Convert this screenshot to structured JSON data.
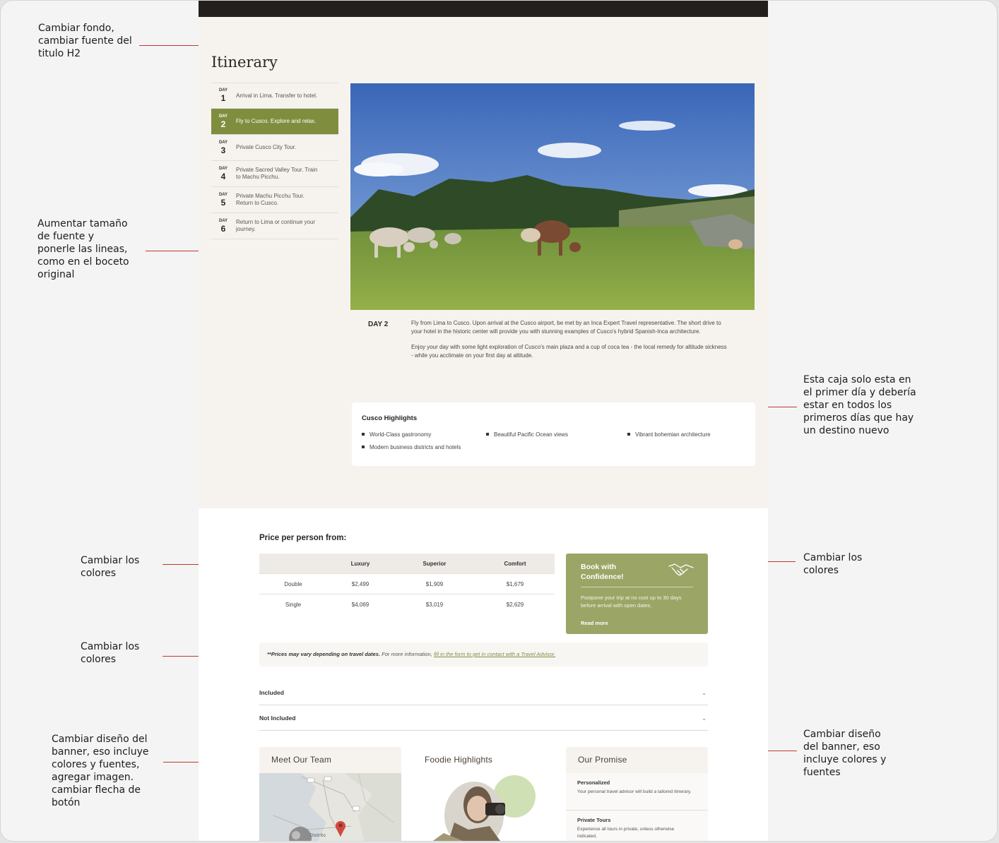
{
  "annotations": [
    "Cambiar fondo,\ncambiar fuente del\ntitulo H2",
    "Aumentar tamaño\nde fuente y\nponerle las lineas,\ncomo en el boceto\noriginal",
    "Esta caja solo esta en\nel primer día y debería\nestar en todos los\nprimeros días que hay\nun destino nuevo",
    "Cambiar los\ncolores",
    "Cambiar los\ncolores",
    "Cambiar los\ncolores",
    "Cambiar diseño del\nbanner, eso incluye\ncolores y fuentes,\nagregar imagen.\ncambiar flecha de\nbotón",
    "Cambiar diseño\ndel banner, eso\nincluye colores y\nfuentes"
  ],
  "itinerary": {
    "title": "Itinerary",
    "day_label": "DAY",
    "days": [
      {
        "num": "1",
        "text": "Arrival in Lima. Transfer to hotel."
      },
      {
        "num": "2",
        "text": "Fly to Cusco. Explore and relax."
      },
      {
        "num": "3",
        "text": "Private Cusco City Tour."
      },
      {
        "num": "4",
        "text": "Private Sacred Valley Tour. Train to Machu Picchu."
      },
      {
        "num": "5",
        "text": "Private Machu Picchu Tour. Return to Cusco."
      },
      {
        "num": "6",
        "text": "Return to Lima or continue your journey."
      }
    ],
    "active_day": "2",
    "detail_tag": "DAY 2",
    "detail_p1": "Fly from Lima to Cusco. Upon arrival at the Cusco airport, be met by an Inca Expert Travel representative. The short drive to your hotel in the historic center will provide you with stunning examples of Cusco's hybrid Spanish-Inca architecture.",
    "detail_p2": "Enjoy your day with some light exploration of Cusco's main plaza and a cup of coca tea - the local remedy for altitude sickness - while you acclimate on your first day at altitude."
  },
  "highlights": {
    "title": "Cusco Highlights",
    "items": [
      "World-Class gastronomy",
      "Beautiful Pacific Ocean views",
      "Vibrant bohemian architecture",
      "Modern business districts and hotels"
    ]
  },
  "pricing": {
    "title": "Price per person from:",
    "columns": [
      "",
      "Luxury",
      "Superior",
      "Comfort"
    ],
    "rows": [
      [
        "Double",
        "$2,499",
        "$1,909",
        "$1,679"
      ],
      [
        "Single",
        "$4,069",
        "$3,019",
        "$2,629"
      ]
    ]
  },
  "book": {
    "title": "Book with Confidence!",
    "text": "Postpone your trip at no cost up to 30 days before arrival with open dates.",
    "link": "Read more",
    "icon": "handshake-icon"
  },
  "price_note": {
    "bold": "**Prices may vary depending on travel dates.",
    "text": " For more information, ",
    "link": "fill in the form to get in contact with a Travel Advisor."
  },
  "accordions": [
    "Included",
    "Not Included"
  ],
  "chevron": "⌄",
  "cards": [
    {
      "title": "Meet Our Team",
      "map_label": "Distrito"
    },
    {
      "title": "Foodie Highlights"
    },
    {
      "title": "Our Promise",
      "items": [
        {
          "title": "Personalized",
          "text": "Your personal travel advisor will build a tailored itinerary."
        },
        {
          "title": "Private Tours",
          "text": "Experience all tours in private, unless otherwise indicated."
        }
      ]
    }
  ],
  "colors": {
    "accent_green": "#7f8e3e",
    "book_green": "#9ba566",
    "annotation_red": "#c0392b",
    "dark_bar": "#231f1c"
  }
}
